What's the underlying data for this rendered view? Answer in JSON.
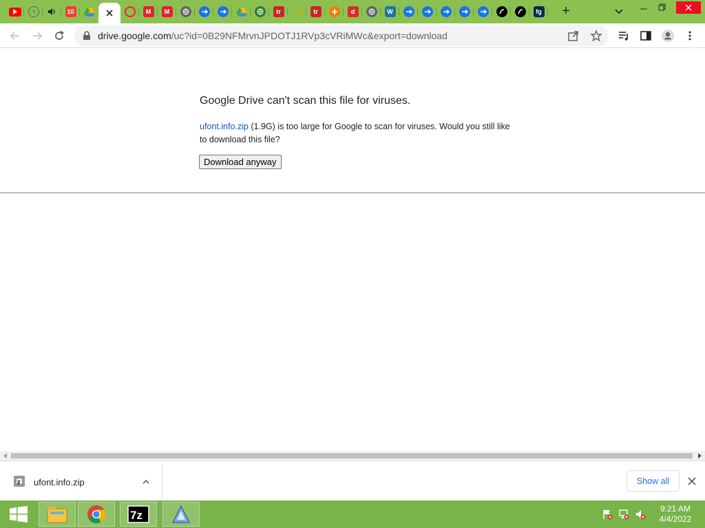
{
  "browser": {
    "tabs": [
      {
        "icon": "youtube-icon",
        "color": "#ff0000"
      },
      {
        "icon": "history-icon",
        "color": "#5f6368"
      },
      {
        "icon": "audio-icon",
        "color": "#202124"
      },
      {
        "icon": "windows10-icon",
        "color": "#e94335",
        "text": "10"
      },
      {
        "icon": "google-drive-icon",
        "color": "#34a853"
      },
      {
        "icon": "close-icon",
        "active": true
      },
      {
        "icon": "opera-icon",
        "color": "#ff1b2d"
      },
      {
        "icon": "mega-icon",
        "color": "#d9272e",
        "text": "M"
      },
      {
        "icon": "mega-icon",
        "color": "#d9272e",
        "text": "M"
      },
      {
        "icon": "globe-icon",
        "color": "#5f6368"
      },
      {
        "icon": "cloud-icon",
        "color": "#1a73e8"
      },
      {
        "icon": "cloud-icon",
        "color": "#1a73e8"
      },
      {
        "icon": "google-drive-icon",
        "color": "#34a853"
      },
      {
        "icon": "globe-color-icon",
        "color": "#2e7d32"
      },
      {
        "icon": "tr-icon",
        "color": "#c62828",
        "text": "tr"
      },
      {
        "icon": "link-icon",
        "color": "#c9b300"
      },
      {
        "icon": "tr-icon",
        "color": "#c62828",
        "text": "tr"
      },
      {
        "icon": "orange-logo-icon",
        "color": "#f57c00"
      },
      {
        "icon": "d-logo-icon",
        "color": "#d32f2f",
        "text": "d"
      },
      {
        "icon": "globe-icon",
        "color": "#5f6368"
      },
      {
        "icon": "wordpress-icon",
        "color": "#21759b",
        "text": "W"
      },
      {
        "icon": "cloud-icon",
        "color": "#1a73e8"
      },
      {
        "icon": "cloud-icon",
        "color": "#1a73e8"
      },
      {
        "icon": "cloud-icon",
        "color": "#1a73e8"
      },
      {
        "icon": "cloud-icon",
        "color": "#1a73e8"
      },
      {
        "icon": "cloud-icon",
        "color": "#1a73e8"
      },
      {
        "icon": "swirl-icon",
        "color": "#000000"
      },
      {
        "icon": "swirl-icon",
        "color": "#000000"
      },
      {
        "icon": "fg-icon",
        "color": "#0d2a4a",
        "text": "fg"
      }
    ],
    "url_host": "drive.google.com",
    "url_path": "/uc?id=0B29NFMrvnJPDOTJ1RVp3cVRiMWc&export=download",
    "accent_color": "#8cc152"
  },
  "page": {
    "title": "Google Drive can't scan this file for viruses.",
    "file_link": "ufont.info.zip",
    "file_size": "(1.9G)",
    "message_rest": "is too large for Google to scan for viruses. Would you still like to download this file?",
    "download_button": "Download anyway"
  },
  "download_bar": {
    "file_name": "ufont.info.zip",
    "show_all_label": "Show all"
  },
  "taskbar": {
    "apps": [
      "start-icon",
      "file-explorer-icon",
      "chrome-icon",
      "7zip-icon",
      "app-icon"
    ],
    "time": "9:21 AM",
    "date": "4/4/2022",
    "color": "#79b44a"
  }
}
